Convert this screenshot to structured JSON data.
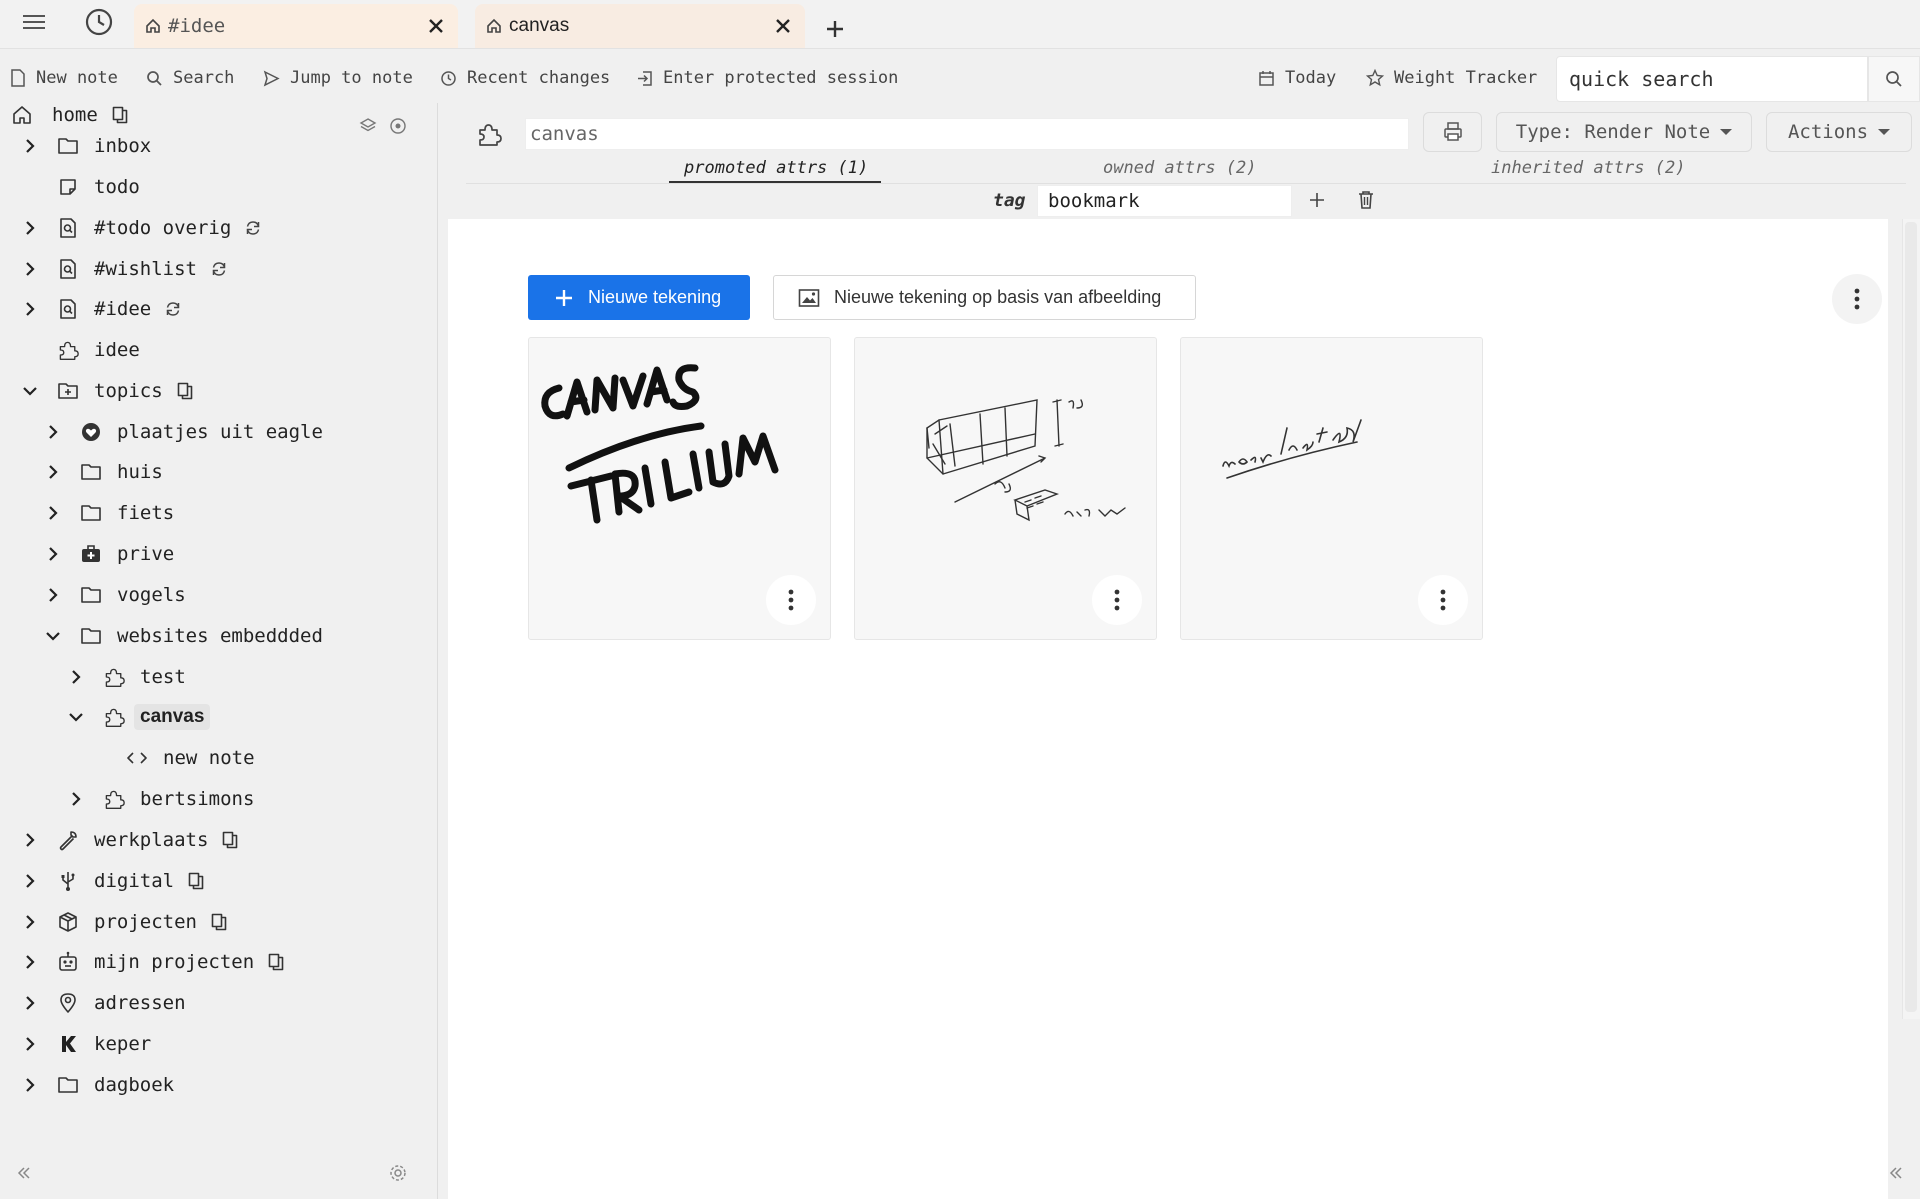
{
  "tabs": [
    {
      "title": "#idee"
    },
    {
      "title": "canvas"
    }
  ],
  "launcher": {
    "new_note": "New note",
    "search": "Search",
    "jump_to_note": "Jump to note",
    "recent_changes": "Recent changes",
    "protected_session": "Enter protected session",
    "today": "Today",
    "weight_tracker": "Weight Tracker",
    "quick_search_placeholder": "quick search"
  },
  "tree": {
    "items": [
      {
        "label": "home"
      },
      {
        "label": "inbox"
      },
      {
        "label": "todo"
      },
      {
        "label": "#todo overig"
      },
      {
        "label": "#wishlist"
      },
      {
        "label": "#idee"
      },
      {
        "label": "idee"
      },
      {
        "label": "topics"
      },
      {
        "label": "plaatjes uit eagle"
      },
      {
        "label": "huis"
      },
      {
        "label": "fiets"
      },
      {
        "label": "prive"
      },
      {
        "label": "vogels"
      },
      {
        "label": "websites embeddded"
      },
      {
        "label": "test"
      },
      {
        "label": "canvas"
      },
      {
        "label": "new note"
      },
      {
        "label": "bertsimons"
      },
      {
        "label": "werkplaats"
      },
      {
        "label": "digital"
      },
      {
        "label": "projecten"
      },
      {
        "label": "mijn projecten"
      },
      {
        "label": "adressen"
      },
      {
        "label": "keper"
      },
      {
        "label": "dagboek"
      }
    ]
  },
  "note": {
    "title": "canvas",
    "type_label": "Type: Render Note",
    "actions_label": "Actions",
    "attr_tabs": {
      "promoted": "promoted attrs (1)",
      "owned": "owned attrs (2)",
      "inherited": "inherited attrs (2)"
    },
    "tag_label": "tag",
    "tag_value": "bookmark"
  },
  "content": {
    "new_drawing": "Nieuwe tekening",
    "new_drawing_from_image": "Nieuwe tekening op basis van afbeelding"
  },
  "colors": {
    "accent": "#1a73e8",
    "tab_active": "#fbeee2"
  }
}
